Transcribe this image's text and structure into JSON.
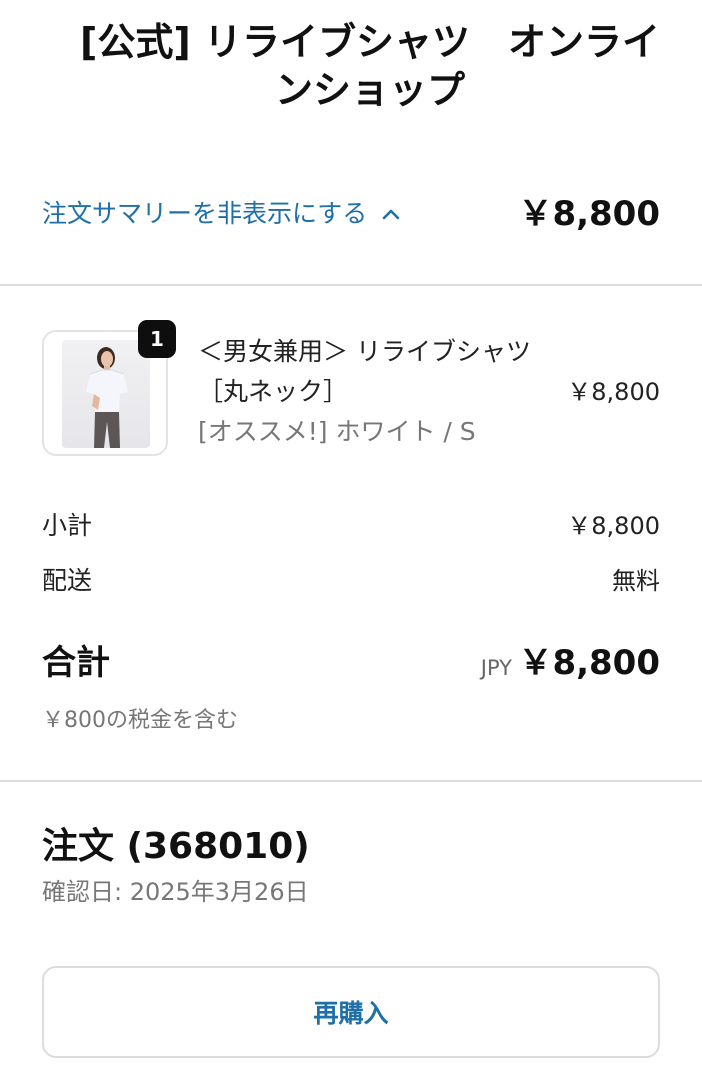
{
  "header": {
    "shop_title": "[公式] リライブシャツ　オンラインショップ"
  },
  "summary": {
    "toggle_label": "注文サマリーを非表示にする",
    "toggle_icon": "chevron-up-icon",
    "total": "￥8,800"
  },
  "line_item": {
    "quantity": "1",
    "name": "＜男女兼用＞ リライブシャツ［丸ネック］",
    "variant": "[オススメ!] ホワイト / S",
    "price": "￥8,800"
  },
  "totals": {
    "subtotal_label": "小計",
    "subtotal_value": "￥8,800",
    "shipping_label": "配送",
    "shipping_value": "無料",
    "total_label": "合計",
    "currency": "JPY",
    "total_value": "￥8,800",
    "tax_note": "￥800の税金を含む"
  },
  "order": {
    "title": "注文 (368010)",
    "confirmed": "確認日: 2025年3月26日",
    "reorder_label": "再購入"
  },
  "colors": {
    "link": "#1f6fa8",
    "divider": "#dcdcdc",
    "badge": "#0e0e0e"
  }
}
